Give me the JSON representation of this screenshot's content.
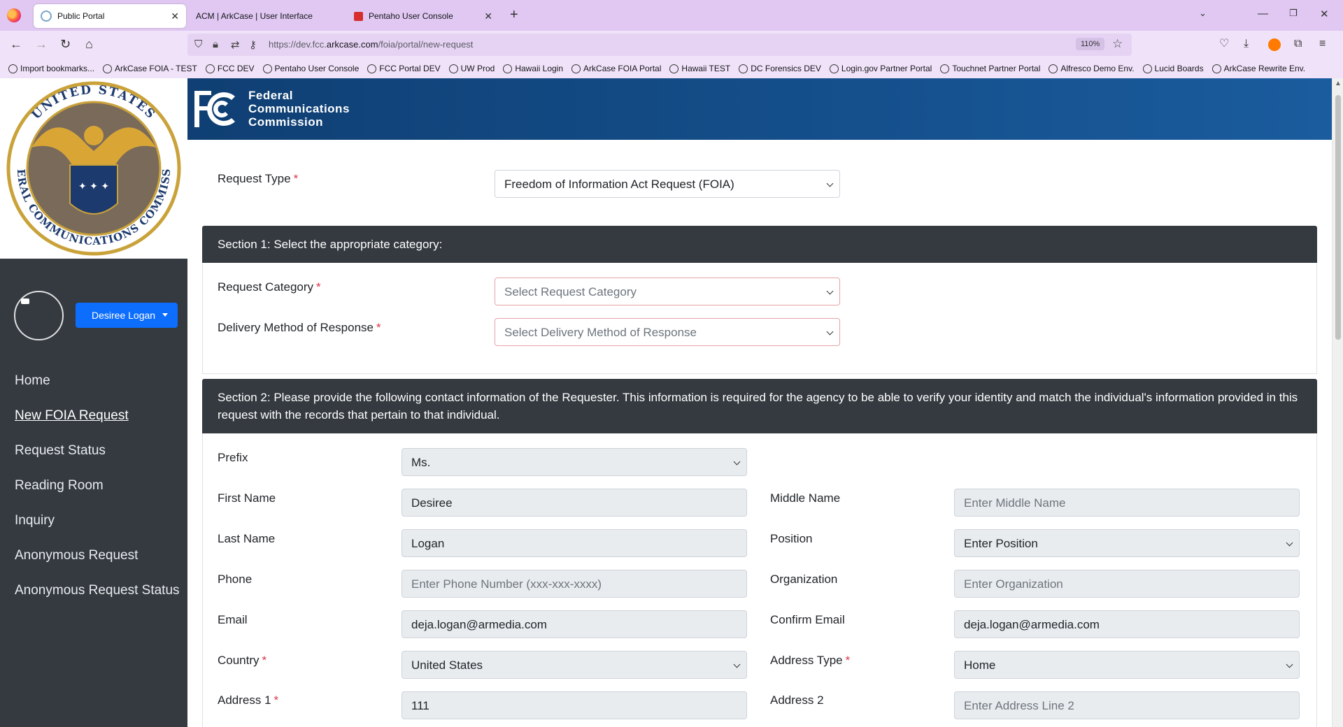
{
  "browser": {
    "tabs": [
      {
        "title": "Public Portal",
        "active": true
      },
      {
        "title": "ACM | ArkCase | User Interface",
        "active": false
      },
      {
        "title": "Pentaho User Console",
        "active": false
      }
    ],
    "url": {
      "prefix": "https://dev.fcc.",
      "domain": "arkcase.com",
      "path": "/foia/portal/new-request"
    },
    "zoom": "110%",
    "bookmarks": [
      "Import bookmarks...",
      "ArkCase FOIA - TEST",
      "FCC DEV",
      "Pentaho User Console",
      "FCC Portal DEV",
      "UW Prod",
      "Hawaii Login",
      "ArkCase FOIA Portal",
      "Hawaii TEST",
      "DC Forensics DEV",
      "Login.gov Partner Portal",
      "Touchnet Partner Portal",
      "Alfresco Demo Env.",
      "Lucid Boards",
      "ArkCase Rewrite Env."
    ]
  },
  "sidebar": {
    "seal_text": {
      "top": "UNITED STATES",
      "bottom": "FEDERAL COMMUNICATIONS COMMISSION"
    },
    "user_name": "Desiree Logan",
    "nav": [
      "Home",
      "New FOIA Request",
      "Request Status",
      "Reading Room",
      "Inquiry",
      "Anonymous Request",
      "Anonymous Request Status"
    ],
    "current_nav": "New FOIA Request"
  },
  "banner": {
    "logo_text": "FCC",
    "line1": "Federal",
    "line2": "Communications",
    "line3": "Commission"
  },
  "form": {
    "request_type": {
      "label": "Request Type",
      "value": "Freedom of Information Act Request (FOIA)"
    },
    "section1": {
      "title": "Section 1: Select the appropriate category:",
      "request_category": {
        "label": "Request Category",
        "placeholder": "Select Request Category"
      },
      "delivery_method": {
        "label": "Delivery Method of Response",
        "placeholder": "Select Delivery Method of Response"
      }
    },
    "section2": {
      "title": "Section 2: Please provide the following contact information of the Requester. This information is required for the agency to be able to verify your identity and match the individual's information provided in this request with the records that pertain to that individual.",
      "prefix": {
        "label": "Prefix",
        "value": "Ms."
      },
      "first_name": {
        "label": "First Name",
        "value": "Desiree"
      },
      "middle_name": {
        "label": "Middle Name",
        "placeholder": "Enter Middle Name"
      },
      "last_name": {
        "label": "Last Name",
        "value": "Logan"
      },
      "position": {
        "label": "Position",
        "placeholder": "Enter Position"
      },
      "phone": {
        "label": "Phone",
        "placeholder": "Enter Phone Number (xxx-xxx-xxxx)"
      },
      "organization": {
        "label": "Organization",
        "placeholder": "Enter Organization"
      },
      "email": {
        "label": "Email",
        "value": "deja.logan@armedia.com"
      },
      "confirm_email": {
        "label": "Confirm Email",
        "value": "deja.logan@armedia.com"
      },
      "country": {
        "label": "Country",
        "value": "United States"
      },
      "address_type": {
        "label": "Address Type",
        "value": "Home"
      },
      "address1": {
        "label": "Address 1",
        "value": "111"
      },
      "address2": {
        "label": "Address 2",
        "placeholder": "Enter Address Line 2"
      }
    }
  },
  "colors": {
    "sidebar": "#343a40",
    "primary_button": "#0d6efd",
    "banner": "#15508d",
    "required": "#dc3545"
  }
}
